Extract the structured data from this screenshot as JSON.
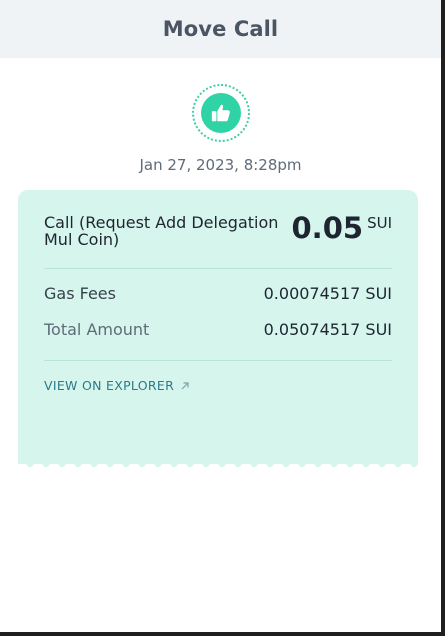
{
  "header": {
    "title": "Move Call"
  },
  "status": {
    "icon": "thumbs-up-icon",
    "date": "Jan 27, 2023, 8:28pm"
  },
  "card": {
    "call_title": "Call (Request Add Delegation Mul Coin)",
    "amount_value": "0.05",
    "amount_unit": "SUI",
    "gas_fees_label": "Gas Fees",
    "gas_fees_value": "0.00074517 SUI",
    "total_label": "Total Amount",
    "total_value": "0.05074517 SUI",
    "explorer_link": "VIEW ON EXPLORER"
  },
  "colors": {
    "accent": "#2fd3a6",
    "card_bg": "#d6f5ec",
    "link": "#2b7a8c"
  }
}
